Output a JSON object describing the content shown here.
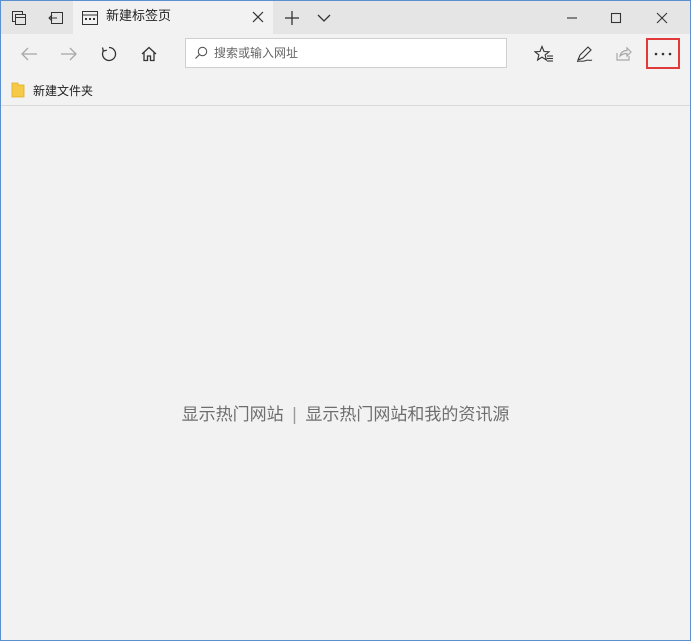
{
  "tab": {
    "title": "新建标签页"
  },
  "address_bar": {
    "placeholder": "搜索或输入网址",
    "value": ""
  },
  "favorites_bar": {
    "items": [
      {
        "label": "新建文件夹",
        "icon": "folder-icon"
      }
    ]
  },
  "content": {
    "link_top_sites": "显示热门网站",
    "separator": "|",
    "link_top_sites_and_feed": "显示热门网站和我的资讯源"
  },
  "colors": {
    "highlight_border": "#e03a3a",
    "folder": "#f7c948",
    "window_border": "#5b8fcf"
  }
}
